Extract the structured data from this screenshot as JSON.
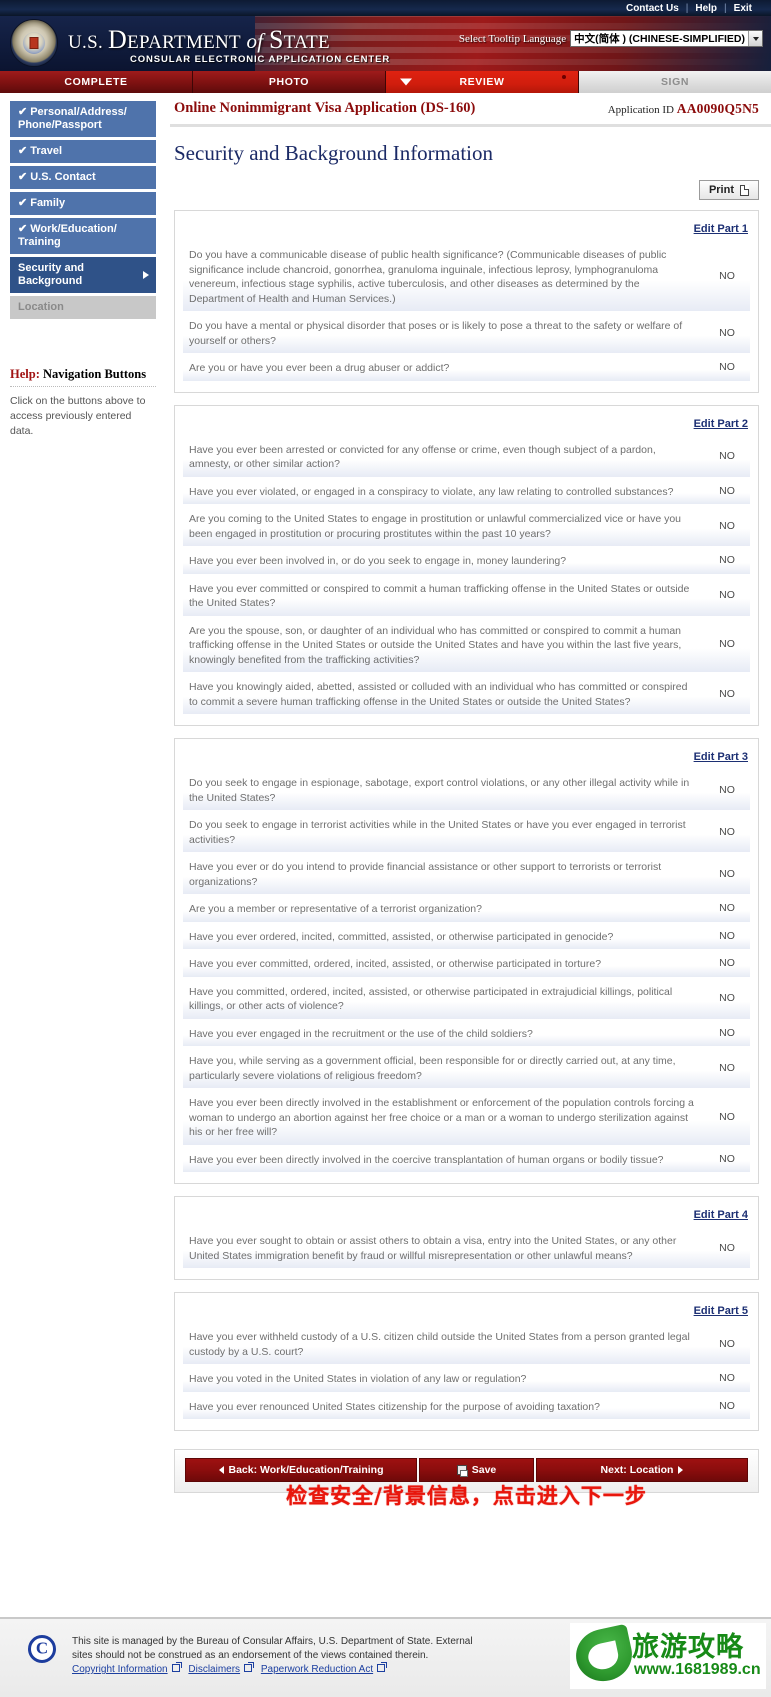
{
  "topbar": {
    "contact": "Contact Us",
    "help": "Help",
    "exit": "Exit"
  },
  "banner": {
    "dept_us": "U.S. ",
    "dept_department": "D",
    "dept_epartment": "EPARTMENT",
    "dept_of": " of ",
    "dept_s": "S",
    "dept_tate": "TATE",
    "subtitle": "CONSULAR ELECTRONIC APPLICATION CENTER",
    "tooltip_label": "Select Tooltip Language",
    "tooltip_value": "中文(简体 ) (CHINESE-SIMPLIFIED)"
  },
  "tabs": [
    {
      "label": "COMPLETE",
      "state": "done"
    },
    {
      "label": "PHOTO",
      "state": "done"
    },
    {
      "label": "REVIEW",
      "state": "active"
    },
    {
      "label": "SIGN",
      "state": "disabled"
    }
  ],
  "apphead": {
    "form_title": "Online Nonimmigrant Visa Application (DS-160)",
    "appid_label": "Application ID ",
    "appid_value": "AA0090Q5N5"
  },
  "page_title": "Security and Background Information",
  "print_label": "Print",
  "sidebar": {
    "items": [
      {
        "label": "Personal/Address/ Phone/Passport",
        "state": "done",
        "check": "✔"
      },
      {
        "label": "Travel",
        "state": "done",
        "check": "✔"
      },
      {
        "label": "U.S. Contact",
        "state": "done",
        "check": "✔"
      },
      {
        "label": "Family",
        "state": "done",
        "check": "✔"
      },
      {
        "label": "Work/Education/ Training",
        "state": "done",
        "check": "✔"
      },
      {
        "label": "Security and Background",
        "state": "current",
        "check": ""
      },
      {
        "label": "Location",
        "state": "future",
        "check": ""
      }
    ],
    "help_title_red": "Help:",
    "help_title_rest": " Navigation Buttons",
    "help_body": "Click on the buttons above to access previously entered data."
  },
  "parts": [
    {
      "edit_label": "Edit Part 1",
      "questions": [
        {
          "q": "Do you have a communicable disease of public health significance? (Communicable diseases of public significance include chancroid, gonorrhea, granuloma inguinale, infectious leprosy, lymphogranuloma venereum, infectious stage syphilis, active tuberculosis, and other diseases as determined by the Department of Health and Human Services.)",
          "a": "NO"
        },
        {
          "q": "Do you have a mental or physical disorder that poses or is likely to pose a threat to the safety or welfare of yourself or others?",
          "a": "NO"
        },
        {
          "q": "Are you or have you ever been a drug abuser or addict?",
          "a": "NO"
        }
      ]
    },
    {
      "edit_label": "Edit Part 2",
      "questions": [
        {
          "q": "Have you ever been arrested or convicted for any offense or crime, even though subject of a pardon, amnesty, or other similar action?",
          "a": "NO"
        },
        {
          "q": "Have you ever violated, or engaged in a conspiracy to violate, any law relating to controlled substances?",
          "a": "NO"
        },
        {
          "q": "Are you coming to the United States to engage in prostitution or unlawful commercialized vice or have you been engaged in prostitution or procuring prostitutes within the past 10 years?",
          "a": "NO"
        },
        {
          "q": "Have you ever been involved in, or do you seek to engage in, money laundering?",
          "a": "NO"
        },
        {
          "q": "Have you ever committed or conspired to commit a human trafficking offense in the United States or outside the United States?",
          "a": "NO"
        },
        {
          "q": "Are you the spouse, son, or daughter of an individual who has committed or conspired to commit a human trafficking offense in the United States or outside the United States and have you within the last five years, knowingly benefited from the trafficking activities?",
          "a": "NO"
        },
        {
          "q": "Have you knowingly aided, abetted, assisted or colluded with an individual who has committed or conspired to commit a severe human trafficking offense in the United States or outside the United States?",
          "a": "NO"
        }
      ]
    },
    {
      "edit_label": "Edit Part 3",
      "questions": [
        {
          "q": "Do you seek to engage in espionage, sabotage, export control violations, or any other illegal activity while in the United States?",
          "a": "NO"
        },
        {
          "q": "Do you seek to engage in terrorist activities while in the United States or have you ever engaged in terrorist activities?",
          "a": "NO"
        },
        {
          "q": "Have you ever or do you intend to provide financial assistance or other support to terrorists or terrorist organizations?",
          "a": "NO"
        },
        {
          "q": "Are you a member or representative of a terrorist organization?",
          "a": "NO"
        },
        {
          "q": "Have you ever ordered, incited, committed, assisted, or otherwise participated in genocide?",
          "a": "NO"
        },
        {
          "q": "Have you ever committed, ordered, incited, assisted, or otherwise participated in torture?",
          "a": "NO"
        },
        {
          "q": "Have you committed, ordered, incited, assisted, or otherwise participated in extrajudicial killings, political killings, or other acts of violence?",
          "a": "NO"
        },
        {
          "q": "Have you ever engaged in the recruitment or the use of the child soldiers?",
          "a": "NO"
        },
        {
          "q": "Have you, while serving as a government official, been responsible for or directly carried out, at any time, particularly severe violations of religious freedom?",
          "a": "NO"
        },
        {
          "q": "Have you ever been directly involved in the establishment or enforcement of the population controls forcing a woman to undergo an abortion against her free choice or a man or a woman to undergo sterilization against his or her free will?",
          "a": "NO"
        },
        {
          "q": "Have you ever been directly involved in the coercive transplantation of human organs or bodily tissue?",
          "a": "NO"
        }
      ]
    },
    {
      "edit_label": "Edit Part 4",
      "questions": [
        {
          "q": "Have you ever sought to obtain or assist others to obtain a visa, entry into the United States, or any other United States immigration benefit by fraud or willful misrepresentation or other unlawful means?",
          "a": "NO"
        }
      ]
    },
    {
      "edit_label": "Edit Part 5",
      "questions": [
        {
          "q": "Have you ever withheld custody of a U.S. citizen child outside the United States from a person granted legal custody by a U.S. court?",
          "a": "NO"
        },
        {
          "q": "Have you voted in the United States in violation of any law or regulation?",
          "a": "NO"
        },
        {
          "q": "Have you ever renounced United States citizenship for the purpose of avoiding taxation?",
          "a": "NO"
        }
      ]
    }
  ],
  "bottom_nav": {
    "back": "Back: Work/Education/Training",
    "save": "Save",
    "next": "Next: Location",
    "annotation": "检查安全/背景信息，点击进入下一步"
  },
  "footer": {
    "line1": "This site is managed by the Bureau of Consular Affairs, U.S. Department of State. External",
    "line2": "sites should not be construed as an endorsement of the views contained therein.",
    "links": [
      "Copyright Information",
      "Disclaimers",
      "Paperwork Reduction Act"
    ]
  },
  "watermark": {
    "cn": "旅游攻略",
    "url": "www.1681989.cn"
  }
}
